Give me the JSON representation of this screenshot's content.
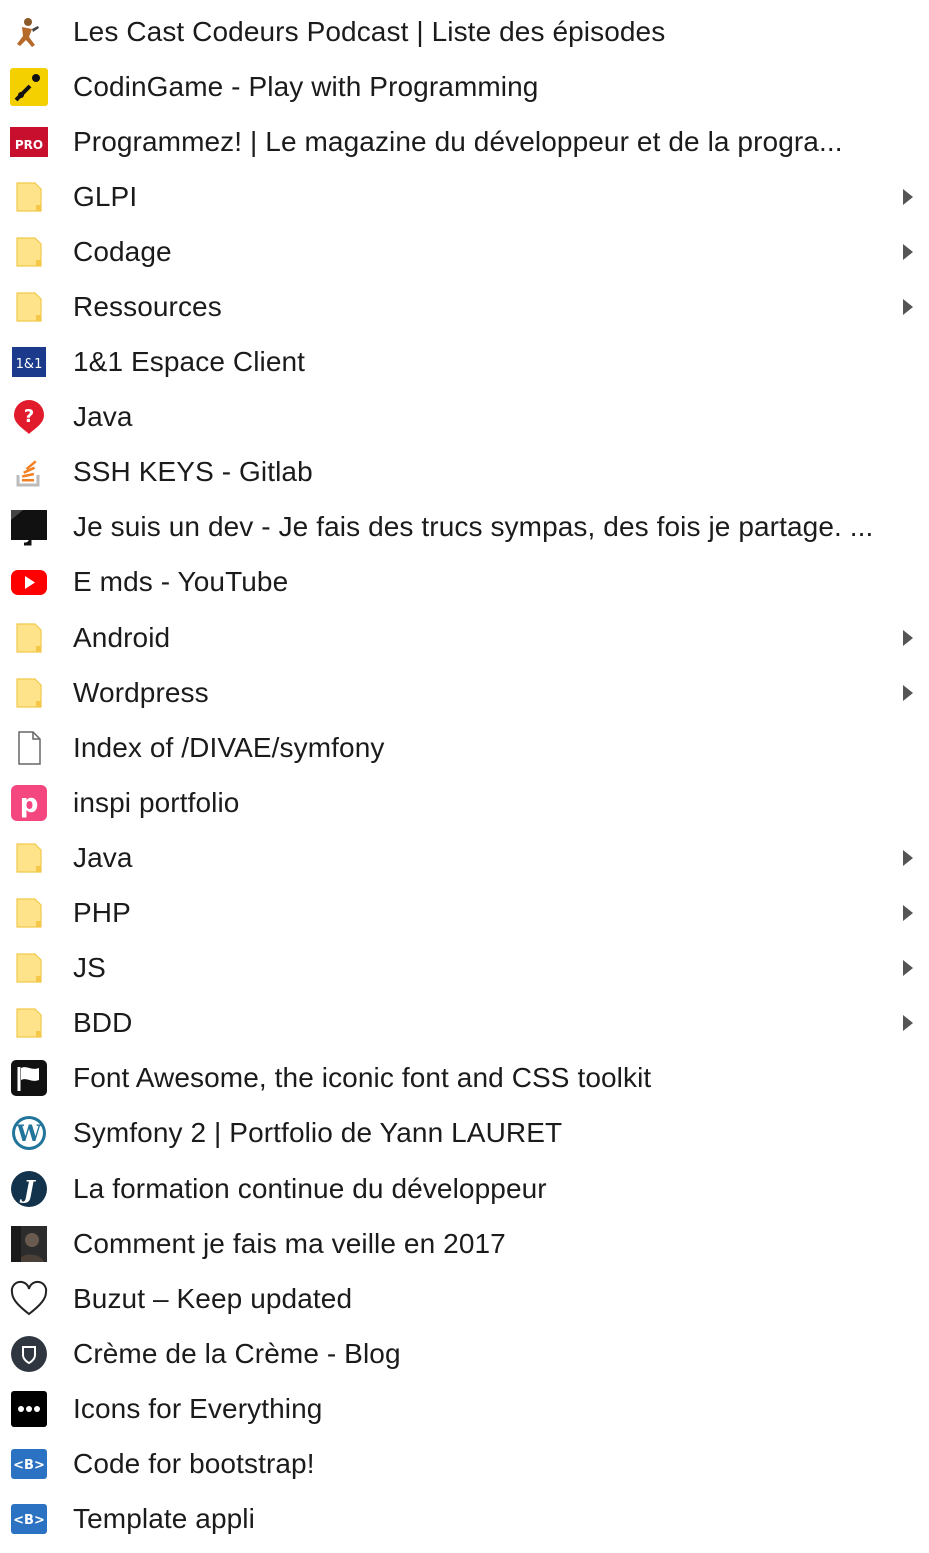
{
  "menu": {
    "items": [
      {
        "label": "Les Cast Codeurs Podcast | Liste des épisodes",
        "icon": "cast-codeurs-icon",
        "type": "link"
      },
      {
        "label": "CodinGame - Play with Programming",
        "icon": "codingame-icon",
        "type": "link"
      },
      {
        "label": "Programmez! | Le magazine du développeur et de la progra...",
        "icon": "programmez-icon",
        "type": "link"
      },
      {
        "label": "GLPI",
        "icon": "folder-icon",
        "type": "folder"
      },
      {
        "label": "Codage",
        "icon": "folder-icon",
        "type": "folder"
      },
      {
        "label": "Ressources",
        "icon": "folder-icon",
        "type": "folder"
      },
      {
        "label": "1&1 Espace Client",
        "icon": "1and1-icon",
        "type": "link"
      },
      {
        "label": "Java",
        "icon": "question-pin-icon",
        "type": "link"
      },
      {
        "label": "SSH KEYS - Gitlab",
        "icon": "stackoverflow-icon",
        "type": "link"
      },
      {
        "label": "Je suis un dev - Je fais des trucs sympas, des fois je partage. ...",
        "icon": "monitor-icon",
        "type": "link"
      },
      {
        "label": "E mds - YouTube",
        "icon": "youtube-icon",
        "type": "link"
      },
      {
        "label": "Android",
        "icon": "folder-icon",
        "type": "folder"
      },
      {
        "label": "Wordpress",
        "icon": "folder-icon",
        "type": "folder"
      },
      {
        "label": "Index of /DIVAE/symfony",
        "icon": "page-icon",
        "type": "link"
      },
      {
        "label": "inspi portfolio",
        "icon": "p-logo-icon",
        "type": "link"
      },
      {
        "label": "Java",
        "icon": "folder-icon",
        "type": "folder"
      },
      {
        "label": "PHP",
        "icon": "folder-icon",
        "type": "folder"
      },
      {
        "label": "JS",
        "icon": "folder-icon",
        "type": "folder"
      },
      {
        "label": "BDD",
        "icon": "folder-icon",
        "type": "folder"
      },
      {
        "label": "Font Awesome, the iconic font and CSS toolkit",
        "icon": "flag-icon",
        "type": "link"
      },
      {
        "label": "Symfony 2 | Portfolio de Yann LAURET",
        "icon": "wordpress-icon",
        "type": "link"
      },
      {
        "label": "La formation continue du développeur",
        "icon": "j-logo-icon",
        "type": "link"
      },
      {
        "label": "Comment je fais ma veille en 2017",
        "icon": "photo-avatar-icon",
        "type": "link"
      },
      {
        "label": "Buzut – Keep updated",
        "icon": "heart-icon",
        "type": "link"
      },
      {
        "label": "Crème de la Crème - Blog",
        "icon": "shield-circle-icon",
        "type": "link"
      },
      {
        "label": "Icons for Everything",
        "icon": "dots-icon",
        "type": "link"
      },
      {
        "label": "Code for bootstrap!",
        "icon": "bootstrap-icon",
        "type": "link"
      },
      {
        "label": "Template appli",
        "icon": "bootstrap-icon",
        "type": "link"
      }
    ]
  },
  "colors": {
    "folder": "#ffe082",
    "folder_stroke": "#e8c452",
    "arrow": "#555555",
    "youtube": "#ff0000",
    "bootstrap": "#2b73c2",
    "programmez": "#c8102e",
    "one_and_one": "#1c3a8c"
  }
}
